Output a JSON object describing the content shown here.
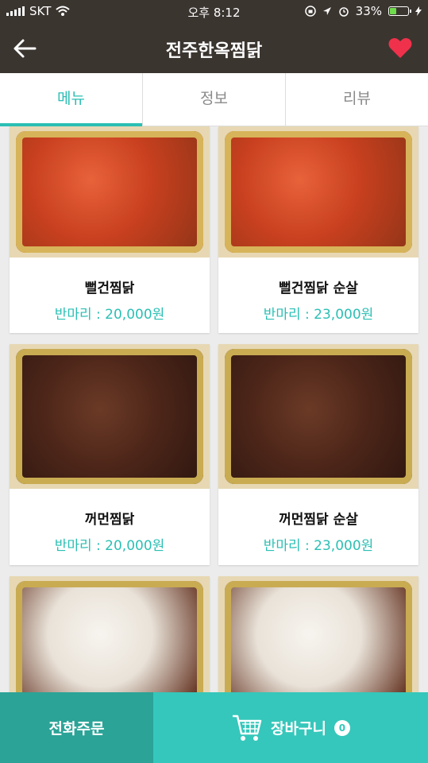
{
  "status": {
    "carrier": "SKT",
    "time": "오후 8:12",
    "battery": "33%"
  },
  "header": {
    "title": "전주한옥찜닭"
  },
  "tabs": [
    {
      "label": "메뉴"
    },
    {
      "label": "정보"
    },
    {
      "label": "리뷰"
    }
  ],
  "menu": [
    {
      "name": "뻘건찜닭",
      "price": "반마리 : 20,000원",
      "style": "red"
    },
    {
      "name": "뻘건찜닭 순살",
      "price": "반마리 : 23,000원",
      "style": "red"
    },
    {
      "name": "꺼먼찜닭",
      "price": "반마리 : 20,000원",
      "style": "dark"
    },
    {
      "name": "꺼먼찜닭 순살",
      "price": "반마리 : 23,000원",
      "style": "dark"
    },
    {
      "name": "",
      "price": "",
      "style": "cheese"
    },
    {
      "name": "",
      "price": "",
      "style": "cheese"
    }
  ],
  "bottom": {
    "phone_label": "전화주문",
    "cart_label": "장바구니",
    "cart_count": "0"
  },
  "colors": {
    "accent": "#2bbfb4",
    "header_bg": "#3b3530",
    "heart": "#f0314b"
  }
}
